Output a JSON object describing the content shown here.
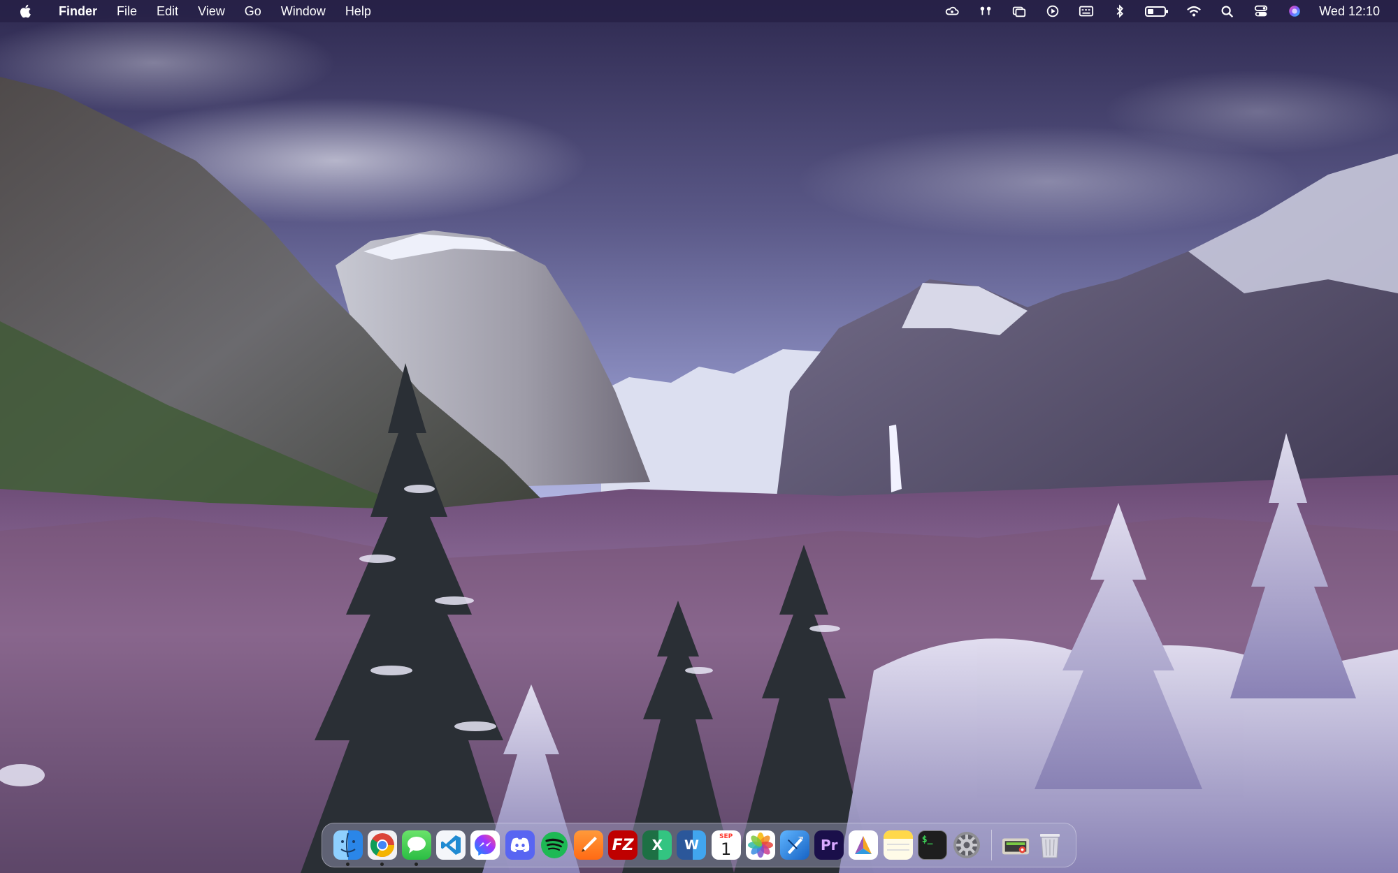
{
  "menubar": {
    "app_name": "Finder",
    "menus": [
      "File",
      "Edit",
      "View",
      "Go",
      "Window",
      "Help"
    ],
    "status_icons": [
      "creative-cloud-icon",
      "airpods-icon",
      "screen-mirror-icon",
      "play-icon",
      "keyboard-icon",
      "bluetooth-icon",
      "battery-icon",
      "wifi-icon",
      "search-icon",
      "control-center-icon",
      "siri-icon"
    ],
    "clock": "Wed 12:10"
  },
  "dock": {
    "apps": [
      {
        "name": "Finder",
        "icon": "finder-icon",
        "color": "#3fa0f0",
        "running": true
      },
      {
        "name": "Google Chrome",
        "icon": "chrome-icon",
        "color": "#ffffff",
        "running": true
      },
      {
        "name": "Messages",
        "icon": "messages-icon",
        "color": "#35c759",
        "running": true
      },
      {
        "name": "Visual Studio Code",
        "icon": "vscode-icon",
        "color": "#ffffff",
        "running": false
      },
      {
        "name": "Messenger",
        "icon": "messenger-icon",
        "color": "#ffffff",
        "running": false
      },
      {
        "name": "Discord",
        "icon": "discord-icon",
        "color": "#5865f2",
        "running": false
      },
      {
        "name": "Spotify",
        "icon": "spotify-icon",
        "color": "#1db954",
        "running": false
      },
      {
        "name": "Sketchbook",
        "icon": "pen-icon",
        "color": "#ff7a1a",
        "running": false
      },
      {
        "name": "FileZilla",
        "icon": "filezilla-icon",
        "color": "#bf0000",
        "running": false,
        "label": "FZ"
      },
      {
        "name": "Microsoft Excel",
        "icon": "excel-icon",
        "color": "#1d7044",
        "running": false,
        "label": "X"
      },
      {
        "name": "Microsoft Word",
        "icon": "word-icon",
        "color": "#2b579a",
        "running": false,
        "label": "W"
      },
      {
        "name": "Calendar",
        "icon": "calendar-icon",
        "color": "#ffffff",
        "running": false,
        "month": "SEP",
        "day": "1"
      },
      {
        "name": "Photos",
        "icon": "photos-icon",
        "color": "#ffffff",
        "running": false
      },
      {
        "name": "Xcode",
        "icon": "xcode-icon",
        "color": "#1f7ad8",
        "running": false
      },
      {
        "name": "Adobe Premiere Pro",
        "icon": "premiere-icon",
        "color": "#1a0f4a",
        "running": false,
        "label": "Pr"
      },
      {
        "name": "Affinity",
        "icon": "affinity-icon",
        "color": "#ffffff",
        "running": false
      },
      {
        "name": "Notes",
        "icon": "notes-icon",
        "color": "#ffd84a",
        "running": false
      },
      {
        "name": "Terminal",
        "icon": "terminal-icon",
        "color": "#1e1e1e",
        "running": false,
        "label": "$_"
      },
      {
        "name": "System Preferences",
        "icon": "gear-icon",
        "color": "#8e8e93",
        "running": false
      }
    ],
    "extras": [
      {
        "name": "Downloads",
        "icon": "downloads-stack-icon"
      },
      {
        "name": "Trash",
        "icon": "trash-icon"
      }
    ]
  }
}
